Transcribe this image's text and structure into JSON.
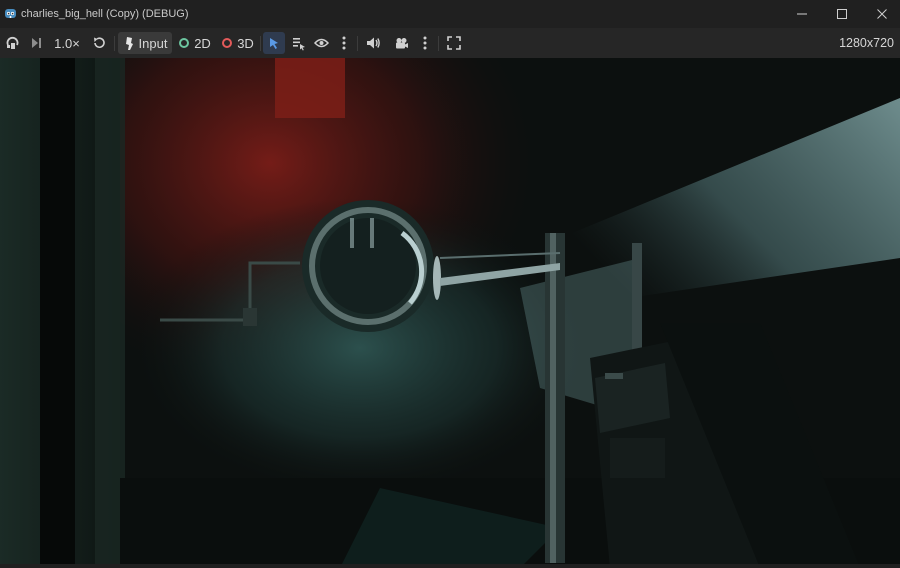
{
  "window": {
    "title": "charlies_big_hell (Copy) (DEBUG)",
    "app_icon": "godot-icon",
    "controls": [
      "minimize-icon",
      "maximize-icon",
      "close-icon"
    ]
  },
  "toolbar": {
    "speed_label": "1.0×",
    "input_label": "Input",
    "mode_2d_label": "2D",
    "mode_3d_label": "3D",
    "resolution_label": "1280x720",
    "icons": [
      "embed-icon",
      "step-frame-icon",
      "reset-speed-icon",
      "input-icon",
      "select-arrow-icon",
      "list-select-icon",
      "visibility-eye-icon",
      "more-vertical-icon",
      "audio-speaker-icon",
      "camera-icon",
      "more-vertical-icon",
      "fullscreen-icon"
    ],
    "colors": {
      "mode_2d": "#6cc6a0",
      "mode_3d": "#e35a5a",
      "select_active": "#5a9ae6"
    }
  },
  "viewport": {
    "description_colors": {
      "wall_red": "#8a1f1a",
      "porthole_cyan": "#2c4d4a",
      "light_beam": "#7ea6a8"
    }
  }
}
